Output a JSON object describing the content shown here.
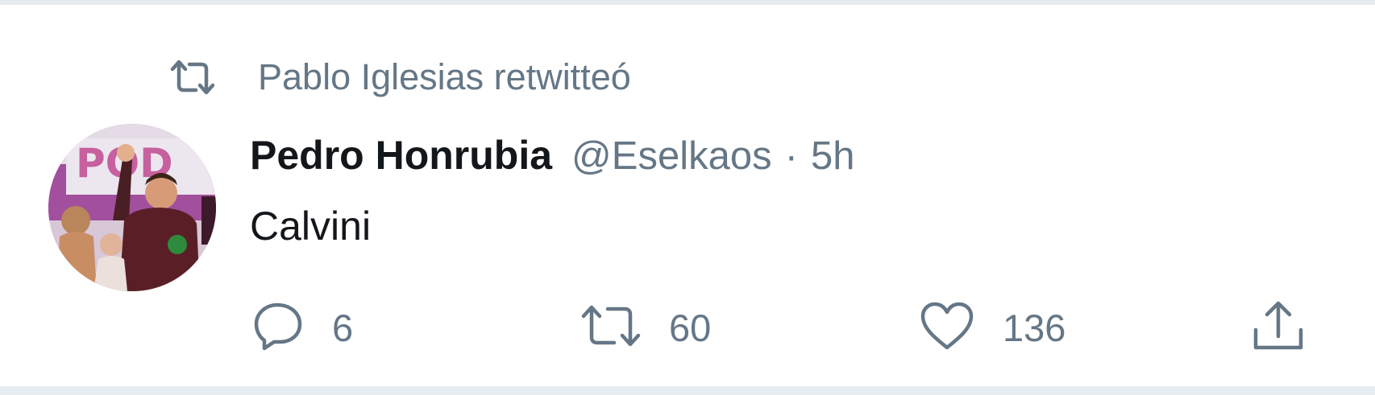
{
  "context": {
    "icon": "retweet-icon",
    "text": "Pablo Iglesias retwitteó"
  },
  "tweet": {
    "display_name": "Pedro Honrubia",
    "handle": "@Eselkaos",
    "separator": "·",
    "time": "5h",
    "text": "Calvini",
    "avatar_sign_text": "POD"
  },
  "actions": {
    "reply": {
      "icon": "reply-icon",
      "count": "6"
    },
    "retweet": {
      "icon": "retweet-icon",
      "count": "60"
    },
    "like": {
      "icon": "heart-icon",
      "count": "136"
    },
    "share": {
      "icon": "share-icon"
    }
  },
  "colors": {
    "secondary_text": "#657786",
    "primary_text": "#14171a",
    "border": "#e6ecf0"
  }
}
